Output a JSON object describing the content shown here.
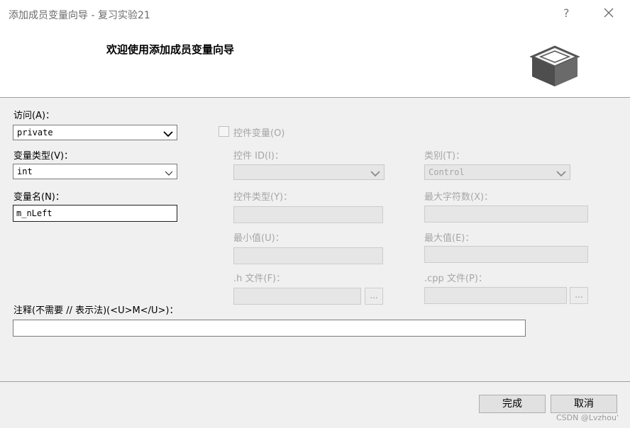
{
  "window": {
    "title": "添加成员变量向导 - 复习实验21",
    "help_label": "?",
    "close_icon": "close-icon"
  },
  "header": {
    "welcome": "欢迎使用添加成员变量向导",
    "icon": "box-icon"
  },
  "form": {
    "access": {
      "label": "访问(A)：",
      "value": "private"
    },
    "var_type": {
      "label": "变量类型(V)：",
      "value": "int"
    },
    "var_name": {
      "label": "变量名(N)：",
      "value": "m_nLeft"
    },
    "control_var": {
      "label": "控件变量(O)",
      "checked": false
    },
    "control_id": {
      "label": "控件 ID(I)：",
      "value": ""
    },
    "category": {
      "label": "类别(T)：",
      "value": "Control"
    },
    "control_type": {
      "label": "控件类型(Y)：",
      "value": ""
    },
    "max_chars": {
      "label": "最大字符数(X)：",
      "value": ""
    },
    "min_value": {
      "label": "最小值(U)：",
      "value": ""
    },
    "max_value": {
      "label": "最大值(E)：",
      "value": ""
    },
    "h_file": {
      "label": ".h 文件(F)：",
      "value": "",
      "browse": "..."
    },
    "cpp_file": {
      "label": ".cpp 文件(P)：",
      "value": "",
      "browse": "..."
    },
    "comment": {
      "label": "注释(不需要 // 表示法)(<U>M</U>)：",
      "value": ""
    }
  },
  "buttons": {
    "finish": "完成",
    "cancel": "取消"
  },
  "watermark": "CSDN @Lvzhou'"
}
